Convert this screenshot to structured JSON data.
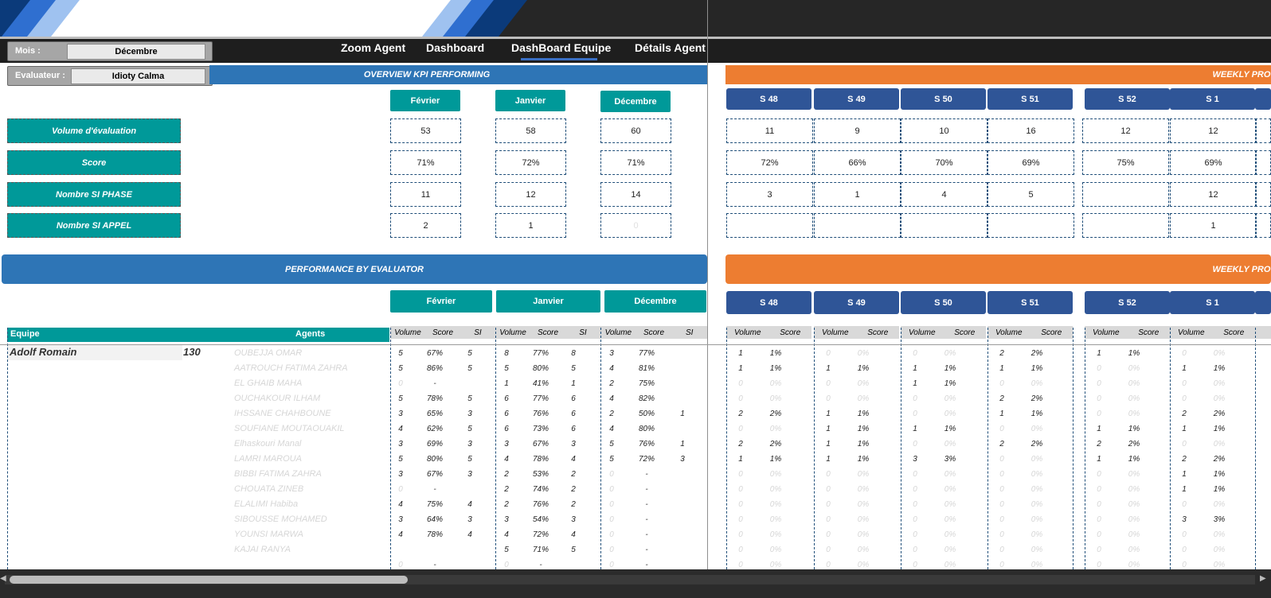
{
  "nav": {
    "items": [
      "Zoom Agent",
      "Dashboard",
      "DashBoard Equipe",
      "Détails Agent"
    ],
    "active": "DashBoard Equipe"
  },
  "filters": {
    "mois_label": "Mois :",
    "mois_value": "Décembre",
    "evaluateur_label": "Evaluateur :",
    "evaluateur_value": "Idioty Calma"
  },
  "overview": {
    "title": "OVERVIEW KPI PERFORMING",
    "weekly_title": "WEEKLY PROG",
    "months": [
      "Février",
      "Janvier",
      "Décembre"
    ],
    "weeks": [
      "S 48",
      "S 49",
      "S 50",
      "S 51",
      "S 52",
      "S 1"
    ],
    "rows": [
      {
        "label": "Volume d'évaluation",
        "months": [
          "53",
          "58",
          "60"
        ],
        "weeks": [
          "11",
          "9",
          "10",
          "16",
          "12",
          "12"
        ]
      },
      {
        "label": "Score",
        "months": [
          "71%",
          "72%",
          "71%"
        ],
        "weeks": [
          "72%",
          "66%",
          "70%",
          "69%",
          "75%",
          "69%"
        ]
      },
      {
        "label": "Nombre SI PHASE",
        "months": [
          "11",
          "12",
          "14"
        ],
        "weeks": [
          "3",
          "1",
          "4",
          "5",
          "",
          "12"
        ]
      },
      {
        "label": "Nombre SI APPEL",
        "months": [
          "2",
          "1",
          "0"
        ],
        "weeks": [
          "",
          "",
          "",
          "",
          "",
          "1"
        ]
      }
    ]
  },
  "performance": {
    "title": "PERFORMANCE  BY EVALUATOR",
    "weekly_title": "WEEKLY PROG",
    "months": [
      "Février",
      "Janvier",
      "Décembre"
    ],
    "weeks": [
      "S 48",
      "S 49",
      "S 50",
      "S 51",
      "S 52",
      "S 1"
    ],
    "col_equipe": "Equipe",
    "col_agents": "Agents",
    "month_sub": [
      "Volume",
      "Score",
      "SI"
    ],
    "week_sub": [
      "Volume",
      "Score"
    ],
    "evaluator": "Adolf Romain",
    "total": "130",
    "agents": [
      {
        "name": "OUBEJJA OMAR",
        "m": [
          "5",
          "67%",
          "5",
          "8",
          "77%",
          "8",
          "3",
          "77%",
          ""
        ],
        "w": [
          "1",
          "1%",
          "0",
          "0%",
          "0",
          "0%",
          "2",
          "2%",
          "1",
          "1%",
          "0",
          "0%"
        ]
      },
      {
        "name": "AATROUCH FATIMA ZAHRA",
        "m": [
          "5",
          "86%",
          "5",
          "5",
          "80%",
          "5",
          "4",
          "81%",
          ""
        ],
        "w": [
          "1",
          "1%",
          "1",
          "1%",
          "1",
          "1%",
          "1",
          "1%",
          "0",
          "0%",
          "1",
          "1%"
        ]
      },
      {
        "name": "EL GHAIB MAHA",
        "m": [
          "0",
          "-",
          "",
          "1",
          "41%",
          "1",
          "2",
          "75%",
          ""
        ],
        "w": [
          "0",
          "0%",
          "0",
          "0%",
          "1",
          "1%",
          "0",
          "0%",
          "0",
          "0%",
          "0",
          "0%"
        ]
      },
      {
        "name": "OUCHAKOUR ILHAM",
        "m": [
          "5",
          "78%",
          "5",
          "6",
          "77%",
          "6",
          "4",
          "82%",
          ""
        ],
        "w": [
          "0",
          "0%",
          "0",
          "0%",
          "0",
          "0%",
          "2",
          "2%",
          "0",
          "0%",
          "0",
          "0%"
        ]
      },
      {
        "name": "IHSSANE CHAHBOUNE",
        "m": [
          "3",
          "65%",
          "3",
          "6",
          "76%",
          "6",
          "2",
          "50%",
          "1"
        ],
        "w": [
          "2",
          "2%",
          "1",
          "1%",
          "0",
          "0%",
          "1",
          "1%",
          "0",
          "0%",
          "2",
          "2%"
        ]
      },
      {
        "name": "SOUFIANE MOUTAOUAKIL",
        "m": [
          "4",
          "62%",
          "5",
          "6",
          "73%",
          "6",
          "4",
          "80%",
          ""
        ],
        "w": [
          "0",
          "0%",
          "1",
          "1%",
          "1",
          "1%",
          "0",
          "0%",
          "1",
          "1%",
          "1",
          "1%"
        ]
      },
      {
        "name": "Elhaskouri Manal",
        "m": [
          "3",
          "69%",
          "3",
          "3",
          "67%",
          "3",
          "5",
          "76%",
          "1"
        ],
        "w": [
          "2",
          "2%",
          "1",
          "1%",
          "0",
          "0%",
          "2",
          "2%",
          "2",
          "2%",
          "0",
          "0%"
        ]
      },
      {
        "name": "LAMRI MAROUA",
        "m": [
          "5",
          "80%",
          "5",
          "4",
          "78%",
          "4",
          "5",
          "72%",
          "3"
        ],
        "w": [
          "1",
          "1%",
          "1",
          "1%",
          "3",
          "3%",
          "0",
          "0%",
          "1",
          "1%",
          "2",
          "2%"
        ]
      },
      {
        "name": "BIBBI FATIMA ZAHRA",
        "m": [
          "3",
          "67%",
          "3",
          "2",
          "53%",
          "2",
          "0",
          "-",
          ""
        ],
        "w": [
          "0",
          "0%",
          "0",
          "0%",
          "0",
          "0%",
          "0",
          "0%",
          "0",
          "0%",
          "1",
          "1%"
        ]
      },
      {
        "name": "CHOUATA  ZINEB",
        "m": [
          "0",
          "-",
          "",
          "2",
          "74%",
          "2",
          "0",
          "-",
          ""
        ],
        "w": [
          "0",
          "0%",
          "0",
          "0%",
          "0",
          "0%",
          "0",
          "0%",
          "0",
          "0%",
          "1",
          "1%"
        ]
      },
      {
        "name": "ELALIMI Habiba",
        "m": [
          "4",
          "75%",
          "4",
          "2",
          "76%",
          "2",
          "0",
          "-",
          ""
        ],
        "w": [
          "0",
          "0%",
          "0",
          "0%",
          "0",
          "0%",
          "0",
          "0%",
          "0",
          "0%",
          "0",
          "0%"
        ]
      },
      {
        "name": "SIBOUSSE MOHAMED",
        "m": [
          "3",
          "64%",
          "3",
          "3",
          "54%",
          "3",
          "0",
          "-",
          ""
        ],
        "w": [
          "0",
          "0%",
          "0",
          "0%",
          "0",
          "0%",
          "0",
          "0%",
          "0",
          "0%",
          "3",
          "3%"
        ]
      },
      {
        "name": "YOUNSI MARWA",
        "m": [
          "4",
          "78%",
          "4",
          "4",
          "72%",
          "4",
          "0",
          "-",
          ""
        ],
        "w": [
          "0",
          "0%",
          "0",
          "0%",
          "0",
          "0%",
          "0",
          "0%",
          "0",
          "0%",
          "0",
          "0%"
        ]
      },
      {
        "name": "KAJAI RANYA",
        "m": [
          "",
          "",
          "",
          "5",
          "71%",
          "5",
          "0",
          "-",
          ""
        ],
        "w": [
          "0",
          "0%",
          "0",
          "0%",
          "0",
          "0%",
          "0",
          "0%",
          "0",
          "0%",
          "0",
          "0%"
        ]
      },
      {
        "name": "",
        "m": [
          "0",
          "-",
          "",
          "0",
          "-",
          "",
          "0",
          "-",
          ""
        ],
        "w": [
          "0",
          "0%",
          "0",
          "0%",
          "0",
          "0%",
          "0",
          "0%",
          "0",
          "0%",
          "0",
          "0%"
        ]
      }
    ]
  },
  "colors": {
    "teal": "#009999",
    "navy": "#2f5597",
    "blue": "#2e75b6",
    "orange": "#ed7d31",
    "faint": "#d6d6d6"
  }
}
